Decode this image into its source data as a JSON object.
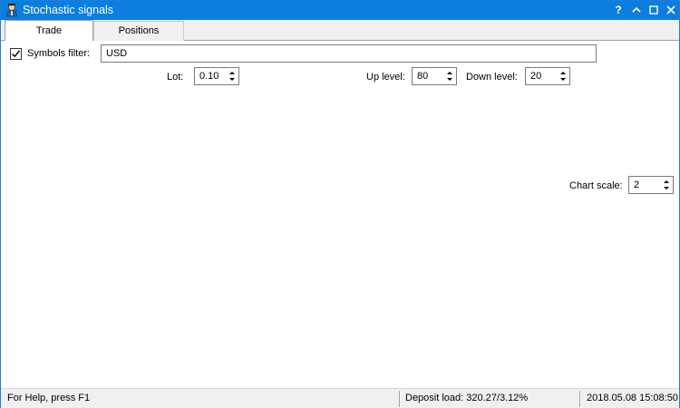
{
  "window": {
    "title": "Stochastic signals",
    "accent_color": "#0b7ee0",
    "icon": "expert-advisor-icon",
    "buttons": [
      "?",
      "^",
      "□",
      "✕"
    ]
  },
  "tabs": [
    {
      "label": "Trade",
      "selected": true
    },
    {
      "label": "Positions",
      "selected": false
    }
  ],
  "filter": {
    "label": "Symbols filter:",
    "checked": true,
    "value": "USD"
  },
  "lot": {
    "label": "Lot:",
    "value": "0.10"
  },
  "up_level": {
    "label": "Up level:",
    "value": "80"
  },
  "down_level": {
    "label": "Down level:",
    "value": "20"
  },
  "chart_scale": {
    "label": "Chart scale:",
    "value": "2"
  },
  "status": {
    "help": "For Help, press F1",
    "deposit": "Deposit load: 320.27/3.12%",
    "datetime": "2018.05.08 15:08:50"
  }
}
